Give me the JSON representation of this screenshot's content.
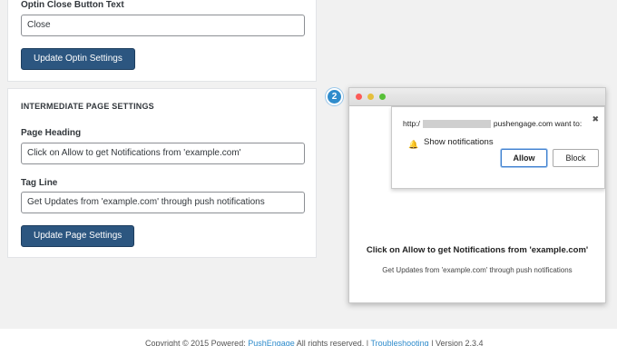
{
  "optin": {
    "close_label": "Optin Close Button Text",
    "close_value": "Close",
    "update_button": "Update Optin Settings"
  },
  "intermediate": {
    "section_title": "INTERMEDIATE PAGE SETTINGS",
    "heading_label": "Page Heading",
    "heading_value": "Click on Allow to get Notifications from 'example.com'",
    "tagline_label": "Tag Line",
    "tagline_value": "Get Updates from 'example.com' through push notifications",
    "update_button": "Update Page Settings"
  },
  "step_badge": "2",
  "preview": {
    "url_prefix": "http:/",
    "url_suffix": "pushengage.com want to:",
    "close_glyph": "✖",
    "bell_glyph": "🔔",
    "bell_icon": "bell-icon",
    "show_notifications": "Show notifications",
    "allow_label": "Allow",
    "block_label": "Block",
    "page_heading": "Click on Allow to get Notifications from 'example.com'",
    "page_tagline": "Get Updates from 'example.com' through push notifications"
  },
  "footer": {
    "copyright": "Copyright © 2015 Powered: ",
    "brand_link": "PushEngage",
    "rights": " All rights reserved. | ",
    "troubleshoot_link": "Troubleshooting",
    "version": " | Version 2.3.4"
  },
  "colors": {
    "primary_button": "#2c5680",
    "badge": "#2f8ccc",
    "allow_border": "#3d7fcf"
  }
}
